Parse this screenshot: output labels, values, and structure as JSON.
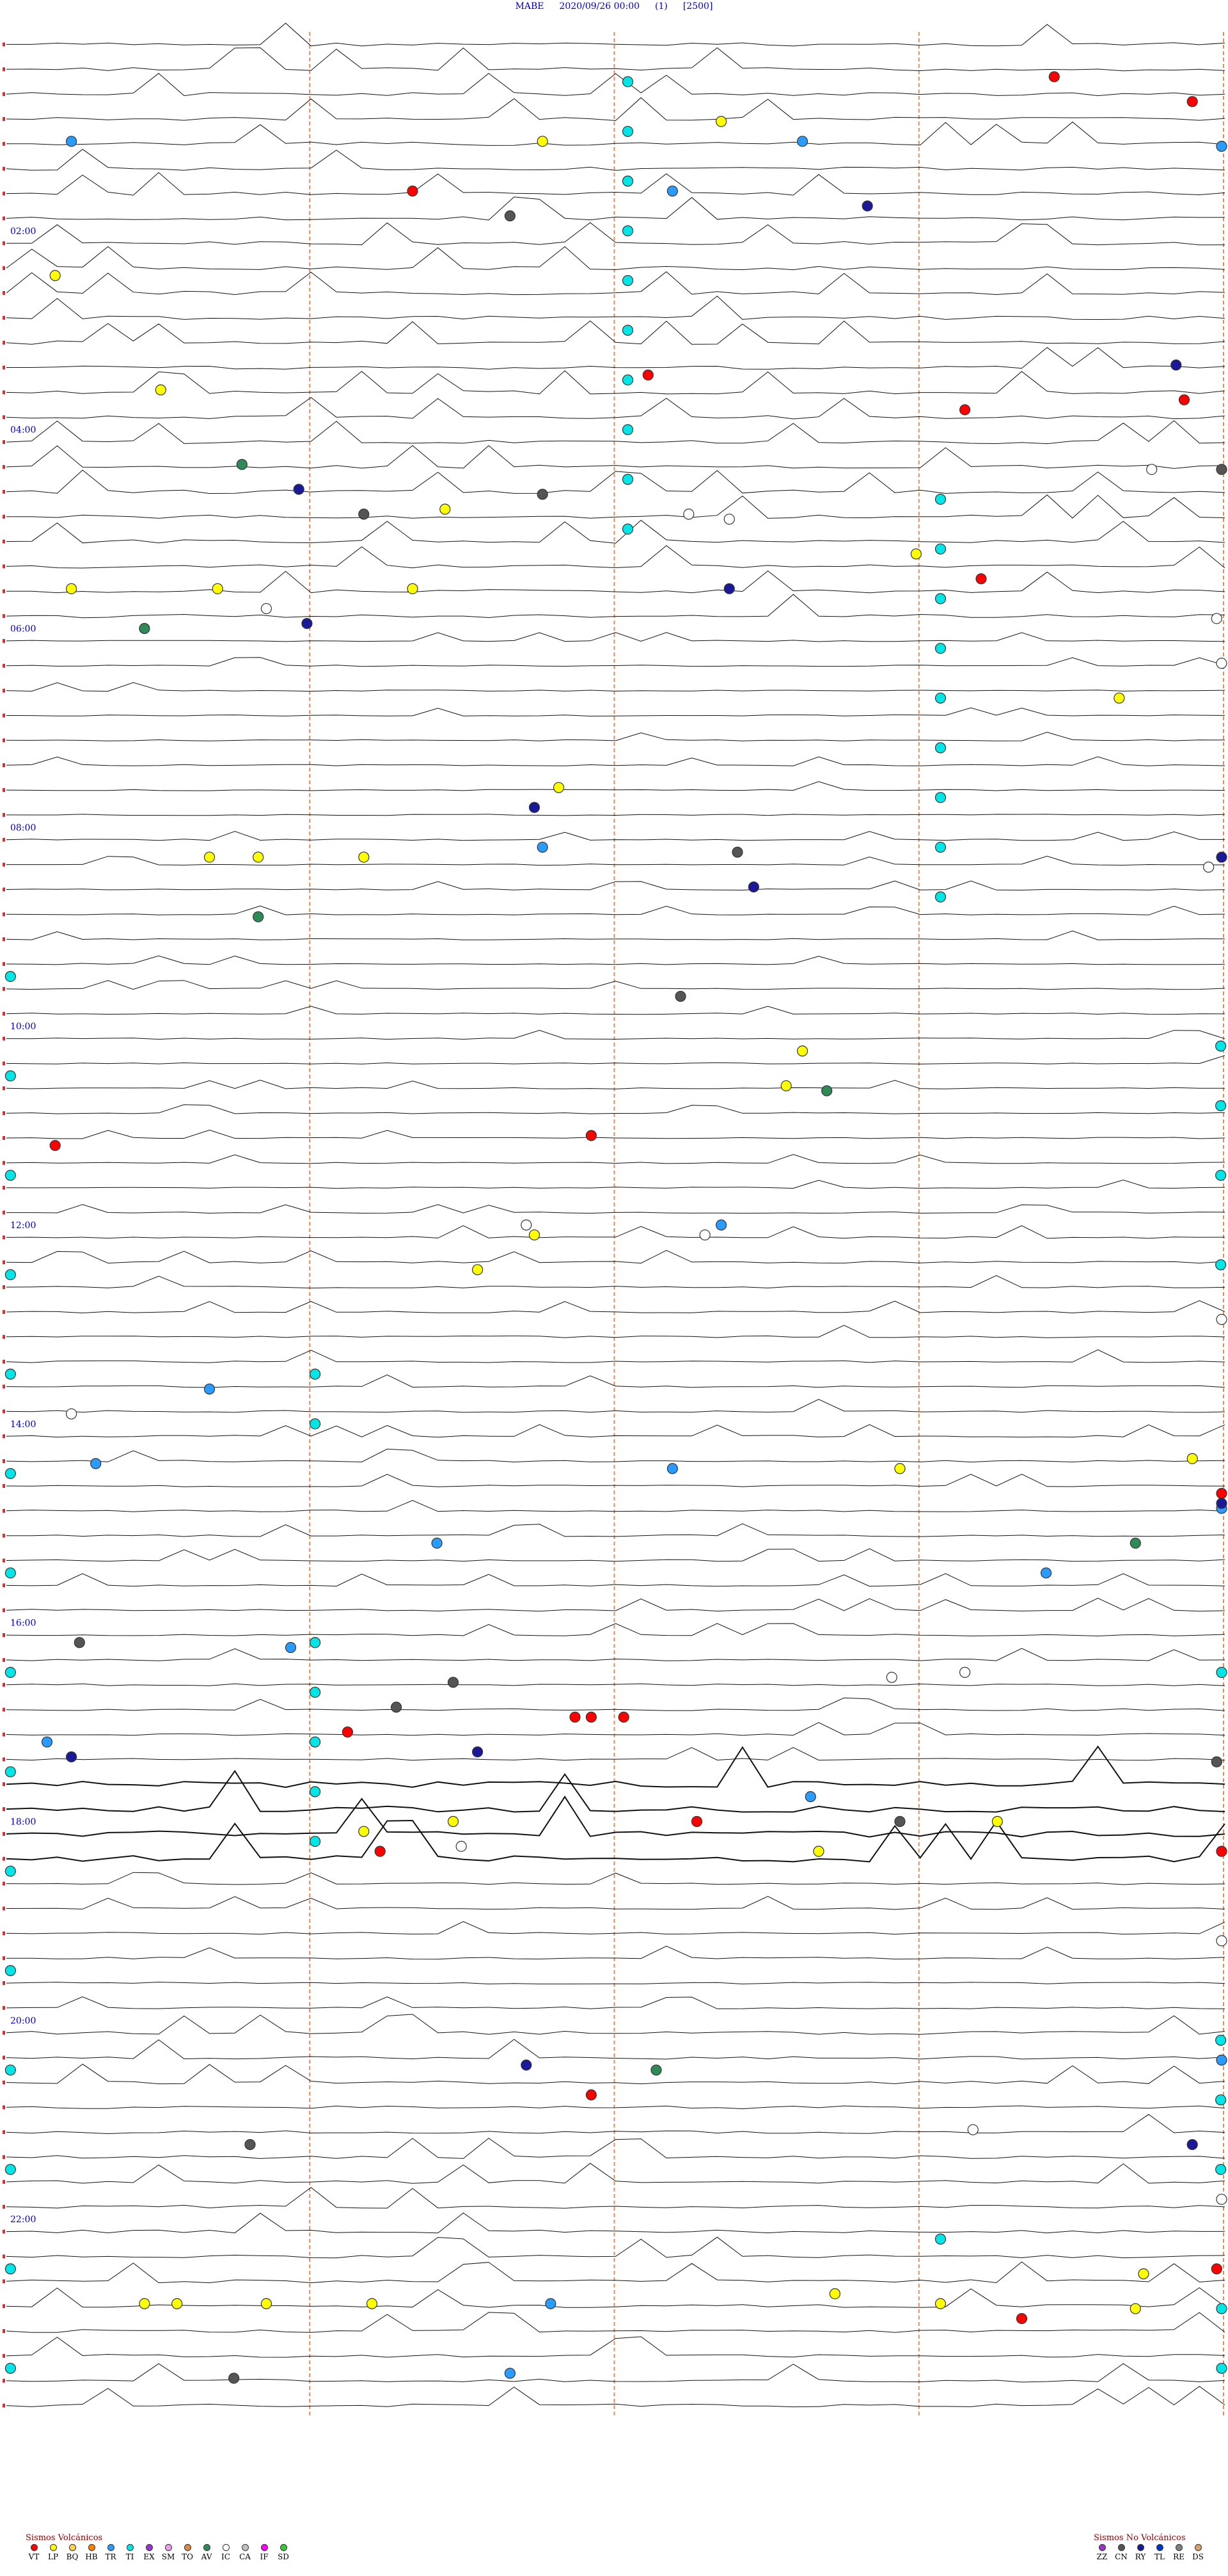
{
  "header": {
    "station": "MABE",
    "datetime": "2020/09/26 00:00",
    "channel": "(1)",
    "scale": "[2500]"
  },
  "hour_labels": [
    "02:00",
    "04:00",
    "06:00",
    "08:00",
    "10:00",
    "12:00",
    "14:00",
    "16:00",
    "18:00",
    "20:00",
    "22:00"
  ],
  "legend_volcanic": {
    "title": "Sismos Volcánicos",
    "items": [
      {
        "code": "VT",
        "color": "#ff0000"
      },
      {
        "code": "LP",
        "color": "#ffff00"
      },
      {
        "code": "BQ",
        "color": "#ffd24d"
      },
      {
        "code": "HB",
        "color": "#ff8000"
      },
      {
        "code": "TR",
        "color": "#2b9cff"
      },
      {
        "code": "TI",
        "color": "#00e5e5"
      },
      {
        "code": "EX",
        "color": "#9933cc"
      },
      {
        "code": "SM",
        "color": "#e8a0e8"
      },
      {
        "code": "TO",
        "color": "#d98c4a"
      },
      {
        "code": "AV",
        "color": "#2e8b57"
      },
      {
        "code": "IC",
        "color": "#ffffff"
      },
      {
        "code": "CA",
        "color": "#c0c0c0"
      },
      {
        "code": "IF",
        "color": "#ff00ff"
      },
      {
        "code": "SD",
        "color": "#33cc33"
      }
    ]
  },
  "legend_nonvolcanic": {
    "title": "Sismos No Volcánicos",
    "items": [
      {
        "code": "ZZ",
        "color": "#9933cc"
      },
      {
        "code": "CN",
        "color": "#555555"
      },
      {
        "code": "RY",
        "color": "#1a1a99"
      },
      {
        "code": "TL",
        "color": "#0033cc"
      },
      {
        "code": "RE",
        "color": "#808080"
      },
      {
        "code": "DS",
        "color": "#d9a06a"
      }
    ]
  },
  "chart_data": {
    "type": "scatter",
    "title": "",
    "start_hour": 0,
    "end_hour": 24,
    "traces_per_hour": 4,
    "minutes_per_trace": 15,
    "xlim_minutes": [
      0,
      15
    ],
    "series": [
      {
        "name": "VT",
        "color": "#ff0000",
        "points": [
          {
            "x": 12.9,
            "y": 0.45
          },
          {
            "x": 14.6,
            "y": 0.7
          },
          {
            "x": 5.0,
            "y": 1.6
          },
          {
            "x": 7.9,
            "y": 3.45
          },
          {
            "x": 11.8,
            "y": 3.8
          },
          {
            "x": 14.5,
            "y": 3.7
          },
          {
            "x": 12.0,
            "y": 5.5
          },
          {
            "x": 7.2,
            "y": 11.1
          },
          {
            "x": 0.6,
            "y": 11.2
          },
          {
            "x": 4.2,
            "y": 17.1
          },
          {
            "x": 7.0,
            "y": 16.95
          },
          {
            "x": 7.2,
            "y": 16.95
          },
          {
            "x": 7.6,
            "y": 16.95
          },
          {
            "x": 8.5,
            "y": 18.0
          },
          {
            "x": 4.6,
            "y": 18.3
          },
          {
            "x": 15.0,
            "y": 18.3
          },
          {
            "x": 7.2,
            "y": 20.75
          },
          {
            "x": 14.9,
            "y": 22.5
          },
          {
            "x": 12.5,
            "y": 23.0
          },
          {
            "x": 18.0,
            "y": 14.7
          }
        ]
      },
      {
        "name": "LP",
        "color": "#ffff00",
        "points": [
          {
            "x": 6.6,
            "y": 1.1
          },
          {
            "x": 8.8,
            "y": 0.9
          },
          {
            "x": 0.6,
            "y": 2.45
          },
          {
            "x": 1.9,
            "y": 3.6
          },
          {
            "x": 5.4,
            "y": 4.8
          },
          {
            "x": 11.2,
            "y": 5.25
          },
          {
            "x": 0.8,
            "y": 5.6
          },
          {
            "x": 2.6,
            "y": 5.6
          },
          {
            "x": 5.0,
            "y": 5.6
          },
          {
            "x": 13.7,
            "y": 6.7
          },
          {
            "x": 6.8,
            "y": 7.6
          },
          {
            "x": 2.5,
            "y": 8.3
          },
          {
            "x": 3.1,
            "y": 8.3
          },
          {
            "x": 4.4,
            "y": 8.3
          },
          {
            "x": 9.8,
            "y": 10.25
          },
          {
            "x": 9.6,
            "y": 10.6
          },
          {
            "x": 6.5,
            "y": 12.1
          },
          {
            "x": 5.8,
            "y": 12.45
          },
          {
            "x": 11.0,
            "y": 14.45
          },
          {
            "x": 14.6,
            "y": 14.35
          },
          {
            "x": 12.2,
            "y": 18.0
          },
          {
            "x": 4.4,
            "y": 18.1
          },
          {
            "x": 5.5,
            "y": 18.0
          },
          {
            "x": 10.0,
            "y": 18.3
          },
          {
            "x": 1.7,
            "y": 22.85
          },
          {
            "x": 2.1,
            "y": 22.85
          },
          {
            "x": 3.2,
            "y": 22.85
          },
          {
            "x": 4.5,
            "y": 22.85
          },
          {
            "x": 10.2,
            "y": 22.75
          },
          {
            "x": 11.5,
            "y": 22.85
          },
          {
            "x": 13.9,
            "y": 22.9
          },
          {
            "x": 14.0,
            "y": 22.55
          }
        ]
      },
      {
        "name": "TR",
        "color": "#2b9cff",
        "points": [
          {
            "x": 0.8,
            "y": 1.1
          },
          {
            "x": 9.8,
            "y": 1.1
          },
          {
            "x": 16.4,
            "y": 1.15
          },
          {
            "x": 8.2,
            "y": 1.6
          },
          {
            "x": 6.6,
            "y": 8.2
          },
          {
            "x": 8.8,
            "y": 12.0
          },
          {
            "x": 2.5,
            "y": 13.65
          },
          {
            "x": 1.1,
            "y": 14.4
          },
          {
            "x": 8.2,
            "y": 14.45
          },
          {
            "x": 15.4,
            "y": 14.85
          },
          {
            "x": 5.3,
            "y": 15.2
          },
          {
            "x": 12.8,
            "y": 15.5
          },
          {
            "x": 3.5,
            "y": 16.25
          },
          {
            "x": 0.5,
            "y": 17.2
          },
          {
            "x": 9.9,
            "y": 17.75
          },
          {
            "x": 6.7,
            "y": 22.85
          },
          {
            "x": 6.2,
            "y": 23.55
          },
          {
            "x": 15.3,
            "y": 20.4
          }
        ]
      },
      {
        "name": "TI",
        "color": "#00e5e5",
        "points": [
          {
            "x": 7.65,
            "y": 0.5
          },
          {
            "x": 7.65,
            "y": 1.0
          },
          {
            "x": 7.65,
            "y": 1.5
          },
          {
            "x": 7.65,
            "y": 2.0
          },
          {
            "x": 7.65,
            "y": 2.5
          },
          {
            "x": 7.65,
            "y": 3.0
          },
          {
            "x": 7.65,
            "y": 3.5
          },
          {
            "x": 7.65,
            "y": 4.0
          },
          {
            "x": 7.65,
            "y": 4.5
          },
          {
            "x": 7.65,
            "y": 5.0
          },
          {
            "x": 11.5,
            "y": 4.7
          },
          {
            "x": 11.5,
            "y": 5.2
          },
          {
            "x": 11.5,
            "y": 5.7
          },
          {
            "x": 11.5,
            "y": 6.2
          },
          {
            "x": 11.5,
            "y": 6.7
          },
          {
            "x": 11.5,
            "y": 7.2
          },
          {
            "x": 11.5,
            "y": 7.7
          },
          {
            "x": 11.5,
            "y": 8.2
          },
          {
            "x": 11.5,
            "y": 8.7
          },
          {
            "x": 0.05,
            "y": 9.5
          },
          {
            "x": 0.05,
            "y": 10.5
          },
          {
            "x": 0.05,
            "y": 11.5
          },
          {
            "x": 0.05,
            "y": 12.5
          },
          {
            "x": 0.05,
            "y": 13.5
          },
          {
            "x": 0.05,
            "y": 14.5
          },
          {
            "x": 0.05,
            "y": 15.5
          },
          {
            "x": 0.05,
            "y": 16.5
          },
          {
            "x": 0.05,
            "y": 17.5
          },
          {
            "x": 0.05,
            "y": 18.5
          },
          {
            "x": 0.05,
            "y": 19.5
          },
          {
            "x": 0.05,
            "y": 20.5
          },
          {
            "x": 0.05,
            "y": 21.5
          },
          {
            "x": 0.05,
            "y": 22.5
          },
          {
            "x": 0.05,
            "y": 23.5
          },
          {
            "x": 14.95,
            "y": 10.2
          },
          {
            "x": 14.95,
            "y": 10.8
          },
          {
            "x": 14.95,
            "y": 11.5
          },
          {
            "x": 14.95,
            "y": 12.4
          },
          {
            "x": 14.95,
            "y": 20.2
          },
          {
            "x": 14.95,
            "y": 20.8
          },
          {
            "x": 14.95,
            "y": 21.5
          },
          {
            "x": 3.8,
            "y": 13.5
          },
          {
            "x": 3.8,
            "y": 14.0
          },
          {
            "x": 3.8,
            "y": 16.2
          },
          {
            "x": 3.8,
            "y": 16.7
          },
          {
            "x": 3.8,
            "y": 17.2
          },
          {
            "x": 3.8,
            "y": 17.7
          },
          {
            "x": 3.8,
            "y": 18.2
          },
          {
            "x": 11.5,
            "y": 22.2
          },
          {
            "x": 15.3,
            "y": 22.9
          },
          {
            "x": 15.3,
            "y": 23.5
          },
          {
            "x": 15.3,
            "y": 16.5
          }
        ]
      },
      {
        "name": "AV",
        "color": "#2e8b57",
        "points": [
          {
            "x": 2.9,
            "y": 4.35
          },
          {
            "x": 1.7,
            "y": 6.0
          },
          {
            "x": 3.1,
            "y": 8.9
          },
          {
            "x": 10.1,
            "y": 10.65
          },
          {
            "x": 13.9,
            "y": 15.2
          },
          {
            "x": 8.0,
            "y": 20.5
          }
        ]
      },
      {
        "name": "IC",
        "color": "#ffffff",
        "points": [
          {
            "x": 14.1,
            "y": 4.4
          },
          {
            "x": 8.4,
            "y": 4.85
          },
          {
            "x": 8.9,
            "y": 4.9
          },
          {
            "x": 3.2,
            "y": 5.8
          },
          {
            "x": 14.9,
            "y": 5.9
          },
          {
            "x": 17.3,
            "y": 6.35
          },
          {
            "x": 14.8,
            "y": 8.4
          },
          {
            "x": 6.4,
            "y": 12.0
          },
          {
            "x": 8.6,
            "y": 12.1
          },
          {
            "x": 17.7,
            "y": 12.95
          },
          {
            "x": 0.8,
            "y": 13.9
          },
          {
            "x": 10.9,
            "y": 16.55
          },
          {
            "x": 11.8,
            "y": 16.5
          },
          {
            "x": 5.6,
            "y": 18.25
          },
          {
            "x": 15.0,
            "y": 19.2
          },
          {
            "x": 11.9,
            "y": 21.1
          },
          {
            "x": 15.1,
            "y": 21.8
          }
        ]
      },
      {
        "name": "CN",
        "color": "#555555",
        "points": [
          {
            "x": 6.2,
            "y": 1.85
          },
          {
            "x": 16.5,
            "y": 4.4
          },
          {
            "x": 4.4,
            "y": 4.85
          },
          {
            "x": 6.6,
            "y": 4.65
          },
          {
            "x": 9.0,
            "y": 8.25
          },
          {
            "x": 8.3,
            "y": 9.7
          },
          {
            "x": 0.9,
            "y": 16.2
          },
          {
            "x": 5.5,
            "y": 16.6
          },
          {
            "x": 4.8,
            "y": 16.85
          },
          {
            "x": 14.9,
            "y": 17.4
          },
          {
            "x": 11.0,
            "y": 18.0
          },
          {
            "x": 3.0,
            "y": 21.25
          },
          {
            "x": 2.8,
            "y": 23.6
          }
        ]
      },
      {
        "name": "RY",
        "color": "#1a1a99",
        "points": [
          {
            "x": 10.6,
            "y": 1.75
          },
          {
            "x": 14.4,
            "y": 3.35
          },
          {
            "x": 3.6,
            "y": 4.6
          },
          {
            "x": 8.9,
            "y": 5.6
          },
          {
            "x": 3.7,
            "y": 5.95
          },
          {
            "x": 6.5,
            "y": 7.8
          },
          {
            "x": 9.2,
            "y": 8.6
          },
          {
            "x": 16.6,
            "y": 8.3
          },
          {
            "x": 0.8,
            "y": 17.35
          },
          {
            "x": 5.8,
            "y": 17.3
          },
          {
            "x": 15.5,
            "y": 14.8
          },
          {
            "x": 6.4,
            "y": 20.45
          },
          {
            "x": 14.6,
            "y": 21.25
          }
        ]
      }
    ]
  }
}
